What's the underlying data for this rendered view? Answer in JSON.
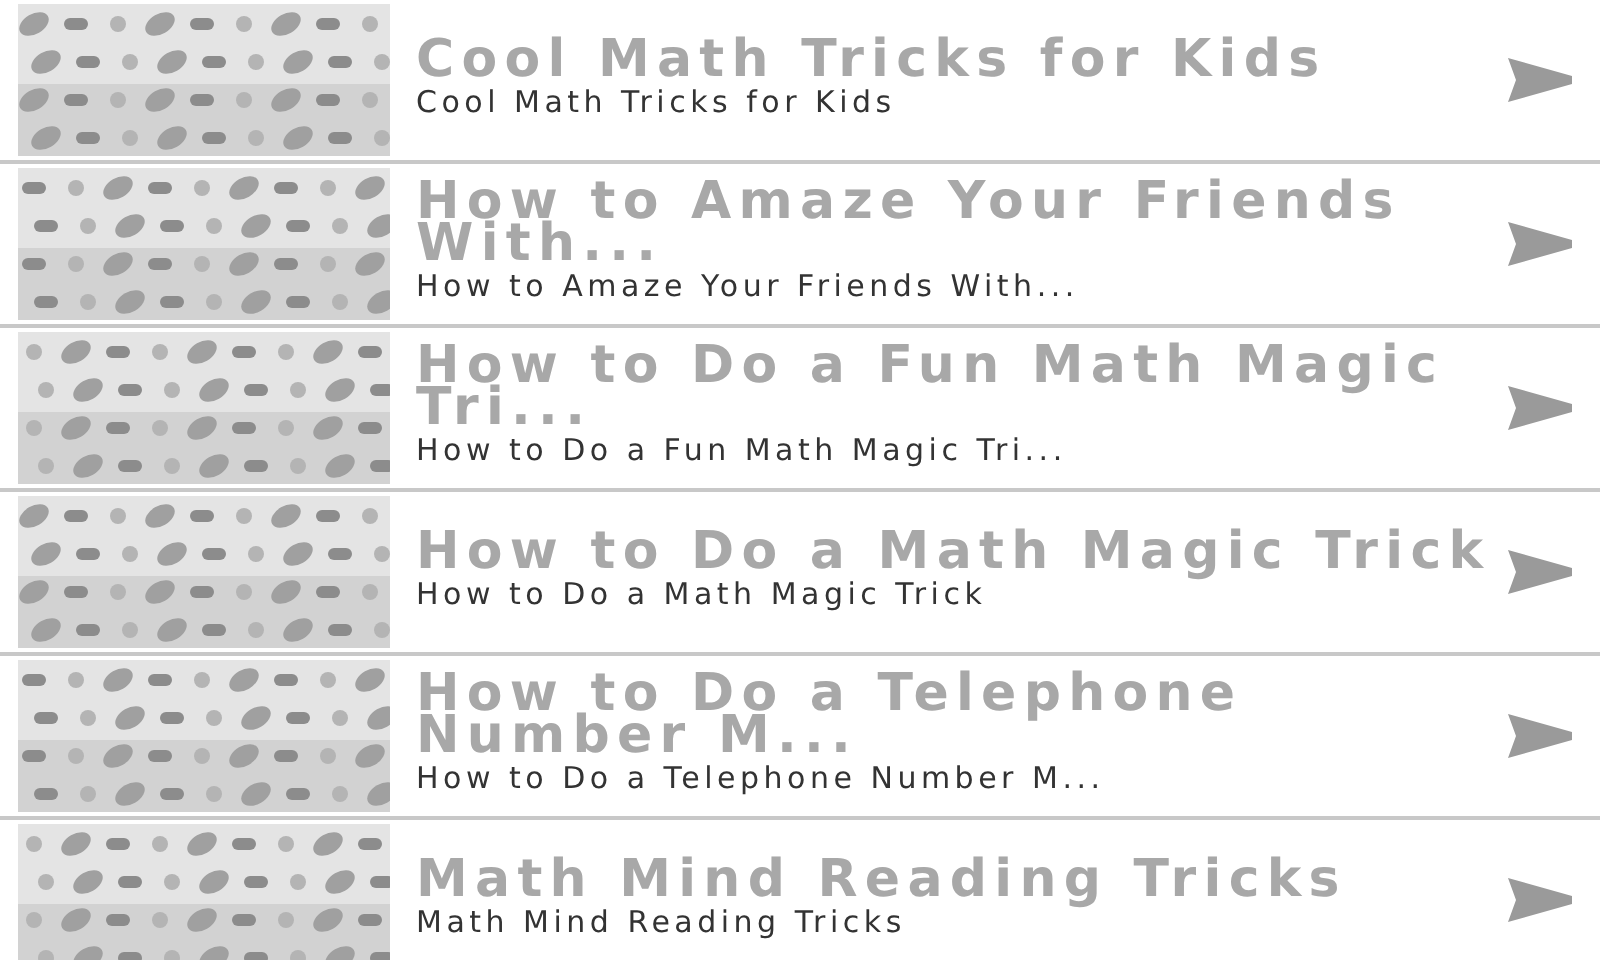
{
  "items": [
    {
      "title": "Cool Math Tricks for Kids",
      "subtitle": "Cool Math Tricks for Kids"
    },
    {
      "title": "How to Amaze Your Friends With...",
      "subtitle": "How to Amaze Your Friends With..."
    },
    {
      "title": "How to Do a Fun Math Magic Tri...",
      "subtitle": "How to Do a Fun Math Magic Tri..."
    },
    {
      "title": "How to Do a Math Magic Trick",
      "subtitle": "How to Do a Math Magic Trick"
    },
    {
      "title": "How to Do a Telephone Number M...",
      "subtitle": "How to Do a Telephone Number M..."
    },
    {
      "title": "Math Mind Reading Tricks",
      "subtitle": "Math Mind Reading Tricks"
    }
  ]
}
